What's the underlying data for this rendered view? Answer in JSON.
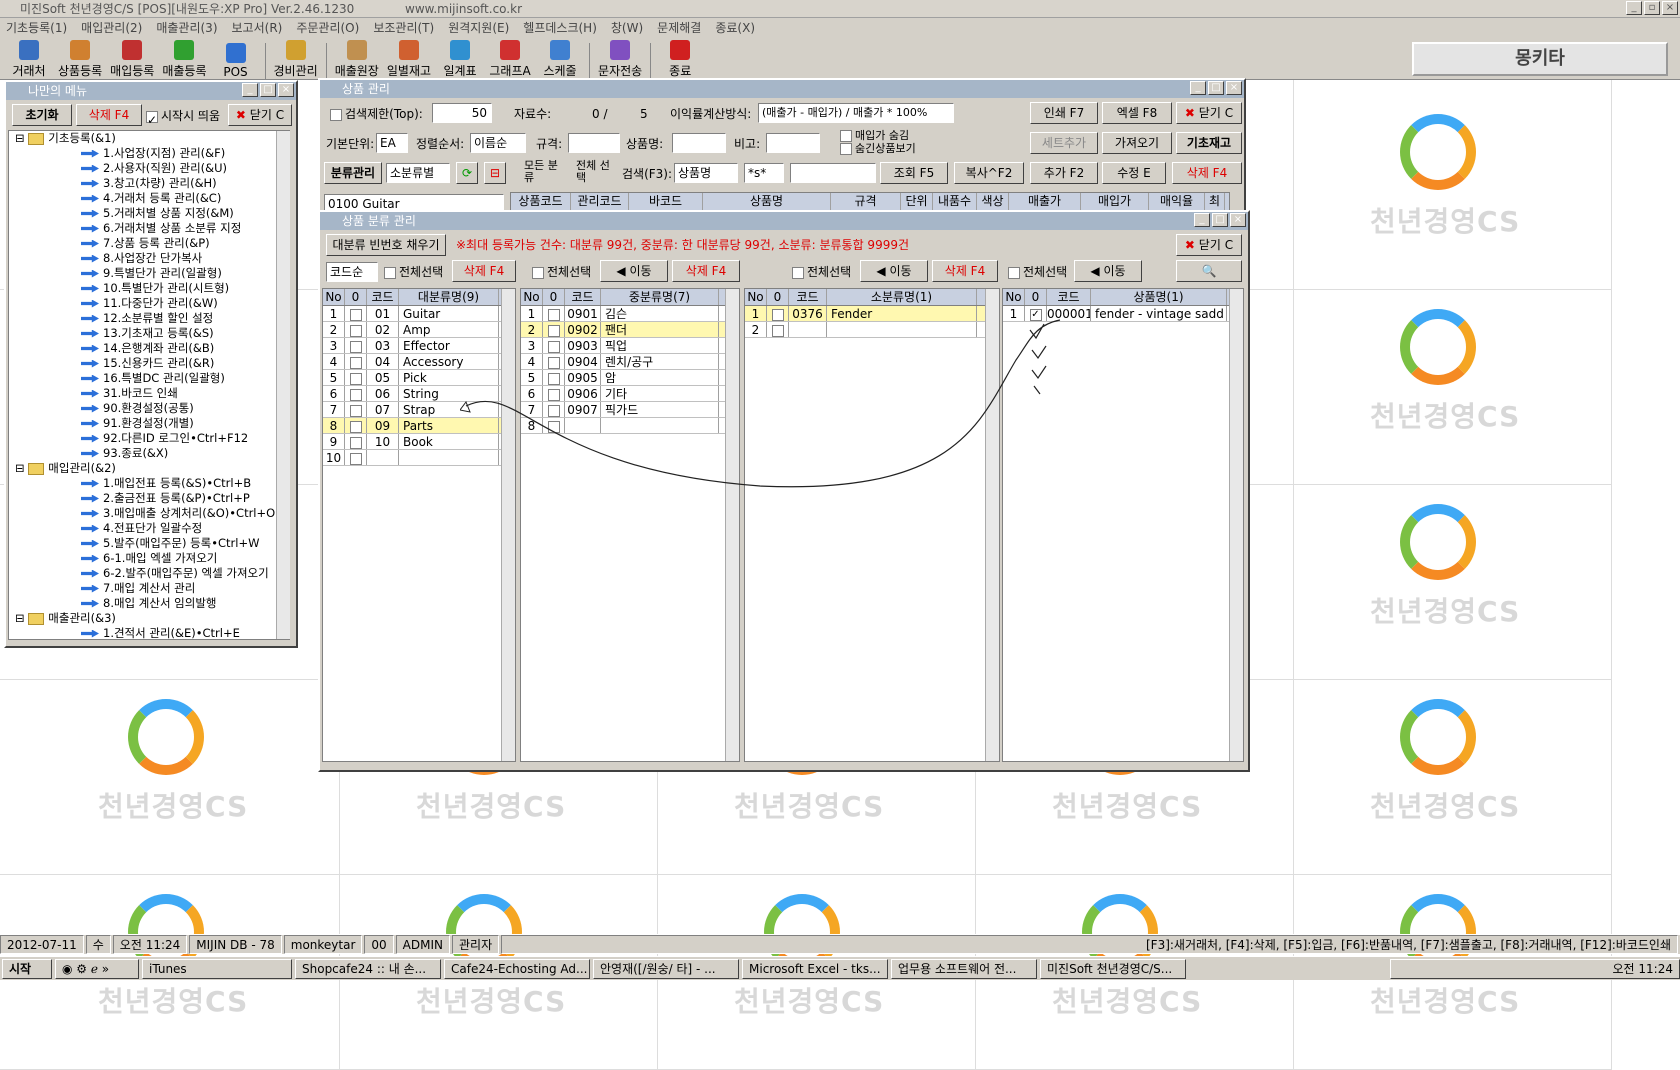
{
  "app": {
    "title": "미진Soft 천년경영C/S [POS][내원도우:XP Pro] Ver.2.46.1230",
    "url": "www.mijinsoft.co.kr",
    "brand": "몽키타"
  },
  "menubar": [
    "기초등록(1)",
    "매입관리(2)",
    "매출관리(3)",
    "보고서(R)",
    "주문관리(O)",
    "보조관리(T)",
    "원격지원(E)",
    "헬프데스크(H)",
    "창(W)",
    "문제해결",
    "종료(X)"
  ],
  "toolbar": [
    "거래처",
    "상품등록",
    "매입등록",
    "매출등록",
    "POS",
    "경비관리",
    "매출원장",
    "일별재고",
    "일계표",
    "그래프A",
    "스케줄",
    "문자전송",
    "종료"
  ],
  "desktop": {
    "logo_text": "천년경영CS"
  },
  "mymenu": {
    "title": "나만의 메뉴",
    "reset": "초기화",
    "delete": "삭제 F4",
    "show_on_start": "시작시 띄움",
    "close": "닫기 C",
    "tree": [
      {
        "t": "f",
        "label": "기초등록(&1)"
      },
      {
        "t": "i",
        "label": "1.사업장(지점) 관리(&F)"
      },
      {
        "t": "i",
        "label": "2.사용자(직원) 관리(&U)"
      },
      {
        "t": "i",
        "label": "3.창고(차량) 관리(&H)"
      },
      {
        "t": "i",
        "label": "4.거래처 등록 관리(&C)"
      },
      {
        "t": "i",
        "label": "5.거래처별 상품 지정(&M)"
      },
      {
        "t": "i",
        "label": "6.거래처별 상품 소분류 지정"
      },
      {
        "t": "i",
        "label": "7.상품 등록 관리(&P)"
      },
      {
        "t": "i",
        "label": "8.사업장간 단가복사"
      },
      {
        "t": "i",
        "label": "9.특별단가 관리(일괄형)"
      },
      {
        "t": "i",
        "label": "10.특별단가 관리(시트형)"
      },
      {
        "t": "i",
        "label": "11.다중단가 관리(&W)"
      },
      {
        "t": "i",
        "label": "12.소분류별 할인 설정"
      },
      {
        "t": "i",
        "label": "13.기초재고 등록(&S)"
      },
      {
        "t": "i",
        "label": "14.은행계좌 관리(&B)"
      },
      {
        "t": "i",
        "label": "15.신용카드 관리(&R)"
      },
      {
        "t": "i",
        "label": "16.특별DC 관리(일괄형)"
      },
      {
        "t": "i",
        "label": "31.바코드 인쇄"
      },
      {
        "t": "i",
        "label": "90.환경설정(공통)"
      },
      {
        "t": "i",
        "label": "91.환경설정(개별)"
      },
      {
        "t": "i",
        "label": "92.다른ID 로그인•Ctrl+F12"
      },
      {
        "t": "i",
        "label": "93.종료(&X)"
      },
      {
        "t": "f",
        "label": "매입관리(&2)"
      },
      {
        "t": "i",
        "label": "1.매입전표 등록(&S)•Ctrl+B"
      },
      {
        "t": "i",
        "label": "2.출금전표 등록(&P)•Ctrl+P"
      },
      {
        "t": "i",
        "label": "3.매입매출 상계처리(&O)•Ctrl+O"
      },
      {
        "t": "i",
        "label": "4.전표단가 일괄수정"
      },
      {
        "t": "i",
        "label": "5.발주(매입주문) 등록•Ctrl+W"
      },
      {
        "t": "i",
        "label": "6-1.매입 엑셀 가져오기"
      },
      {
        "t": "i",
        "label": "6-2.발주(매입주문) 엑셀 가져오기"
      },
      {
        "t": "i",
        "label": "7.매입 계산서 관리"
      },
      {
        "t": "i",
        "label": "8.매입 계산서 임의발행"
      },
      {
        "t": "f",
        "label": "매출관리(&3)"
      },
      {
        "t": "i",
        "label": "1.견적서 관리(&E)•Ctrl+E"
      }
    ]
  },
  "product": {
    "title": "상품 관리",
    "search_limit": "검색제한(Top):",
    "limit_value": "50",
    "count_label": "자료수:",
    "count_value": "0 /",
    "count_total": "5",
    "margin_label": "이익률계산방식:",
    "margin_value": "(매출가 - 매입가) / 매출가 * 100%",
    "print": "인쇄 F7",
    "excel": "엑셀 F8",
    "close": "닫기 C",
    "base_unit": "기본단위:",
    "unit_value": "EA",
    "sort_label": "정렬순서:",
    "sort_value": "이름순",
    "spec": "규격:",
    "pname": "상품명:",
    "note": "비고:",
    "hide_buy": "매입가 숨김",
    "show_hidden": "숨긴상품보기",
    "set_add": "세트추가",
    "import": "가져오기",
    "init_stock": "기초재고",
    "cat_manage": "분류관리",
    "cat_select": "소분류별",
    "all_cat": "모든 분류",
    "all_sel": "전체 선택",
    "search_label": "검색(F3):",
    "search_field": "상품명",
    "search_mode": "*s*",
    "query": "조회 F5",
    "copy": "복사^F2",
    "add": "추가 F2",
    "edit": "수정 E",
    "del": "삭제 F4",
    "cat_value": "0100 Guitar",
    "columns": [
      "상품코드",
      "관리코드",
      "바코드",
      "상품명",
      "규격",
      "단위",
      "내품수",
      "색상",
      "매출가",
      "매입가",
      "매익율",
      "최"
    ]
  },
  "category": {
    "title": "상품 분류 관리",
    "renumber": "대분류 빈번호 채우기",
    "notice": "※최대 등록가능 건수: 대분류 99건, 중분류: 한 대분류당 99건, 소분류: 분류통합 9999건",
    "close": "닫기 C",
    "order": "코드순",
    "select_all": "전체선택",
    "delete": "삭제 F4",
    "move": "이동",
    "large": {
      "headers": [
        "No",
        "0",
        "코드",
        "대분류명(9)"
      ],
      "rows": [
        [
          "1",
          "",
          "01",
          "Guitar"
        ],
        [
          "2",
          "",
          "02",
          "Amp"
        ],
        [
          "3",
          "",
          "03",
          "Effector"
        ],
        [
          "4",
          "",
          "04",
          "Accessory"
        ],
        [
          "5",
          "",
          "05",
          "Pick"
        ],
        [
          "6",
          "",
          "06",
          "String"
        ],
        [
          "7",
          "",
          "07",
          "Strap"
        ],
        [
          "8",
          "",
          "09",
          "Parts"
        ],
        [
          "9",
          "",
          "10",
          "Book"
        ],
        [
          "10",
          "",
          "",
          ""
        ]
      ]
    },
    "medium": {
      "headers": [
        "No",
        "0",
        "코드",
        "중분류명(7)"
      ],
      "rows": [
        [
          "1",
          "",
          "0901",
          "김슨"
        ],
        [
          "2",
          "",
          "0902",
          "팬더"
        ],
        [
          "3",
          "",
          "0903",
          "픽업"
        ],
        [
          "4",
          "",
          "0904",
          "렌치/공구"
        ],
        [
          "5",
          "",
          "0905",
          "암"
        ],
        [
          "6",
          "",
          "0906",
          "기타"
        ],
        [
          "7",
          "",
          "0907",
          "픽가드"
        ],
        [
          "8",
          "",
          "",
          ""
        ]
      ]
    },
    "small": {
      "headers": [
        "No",
        "0",
        "코드",
        "소분류명(1)"
      ],
      "rows": [
        [
          "1",
          "",
          "0376",
          "Fender"
        ],
        [
          "2",
          "",
          "",
          ""
        ]
      ]
    },
    "items": {
      "headers": [
        "No",
        "0",
        "코드",
        "상품명(1)"
      ],
      "rows": [
        [
          "1",
          "✓",
          "000001",
          "fender - vintage sadd"
        ]
      ]
    }
  },
  "status": [
    "2012-07-11",
    "수",
    "오전 11:24",
    "MIJIN DB - 78",
    "monkeytar",
    "00",
    "ADMIN",
    "관리자",
    "[F3]:새거래처, [F4]:삭제, [F5]:입금, [F6]:반품내역, [F7]:샘플출고, [F8]:거래내역, [F12]:바코드인쇄"
  ],
  "taskbar": {
    "start": "시작",
    "tasks": [
      "iTunes",
      "Shopcafe24 :: 내 손...",
      "Cafe24-Echosting Ad...",
      "안영재([/원숭/ 타] - ...",
      "Microsoft Excel - tks...",
      "업무용 소프트웨어 전...",
      "미진Soft 천년경영C/S..."
    ],
    "clock": "오전 11:24"
  }
}
